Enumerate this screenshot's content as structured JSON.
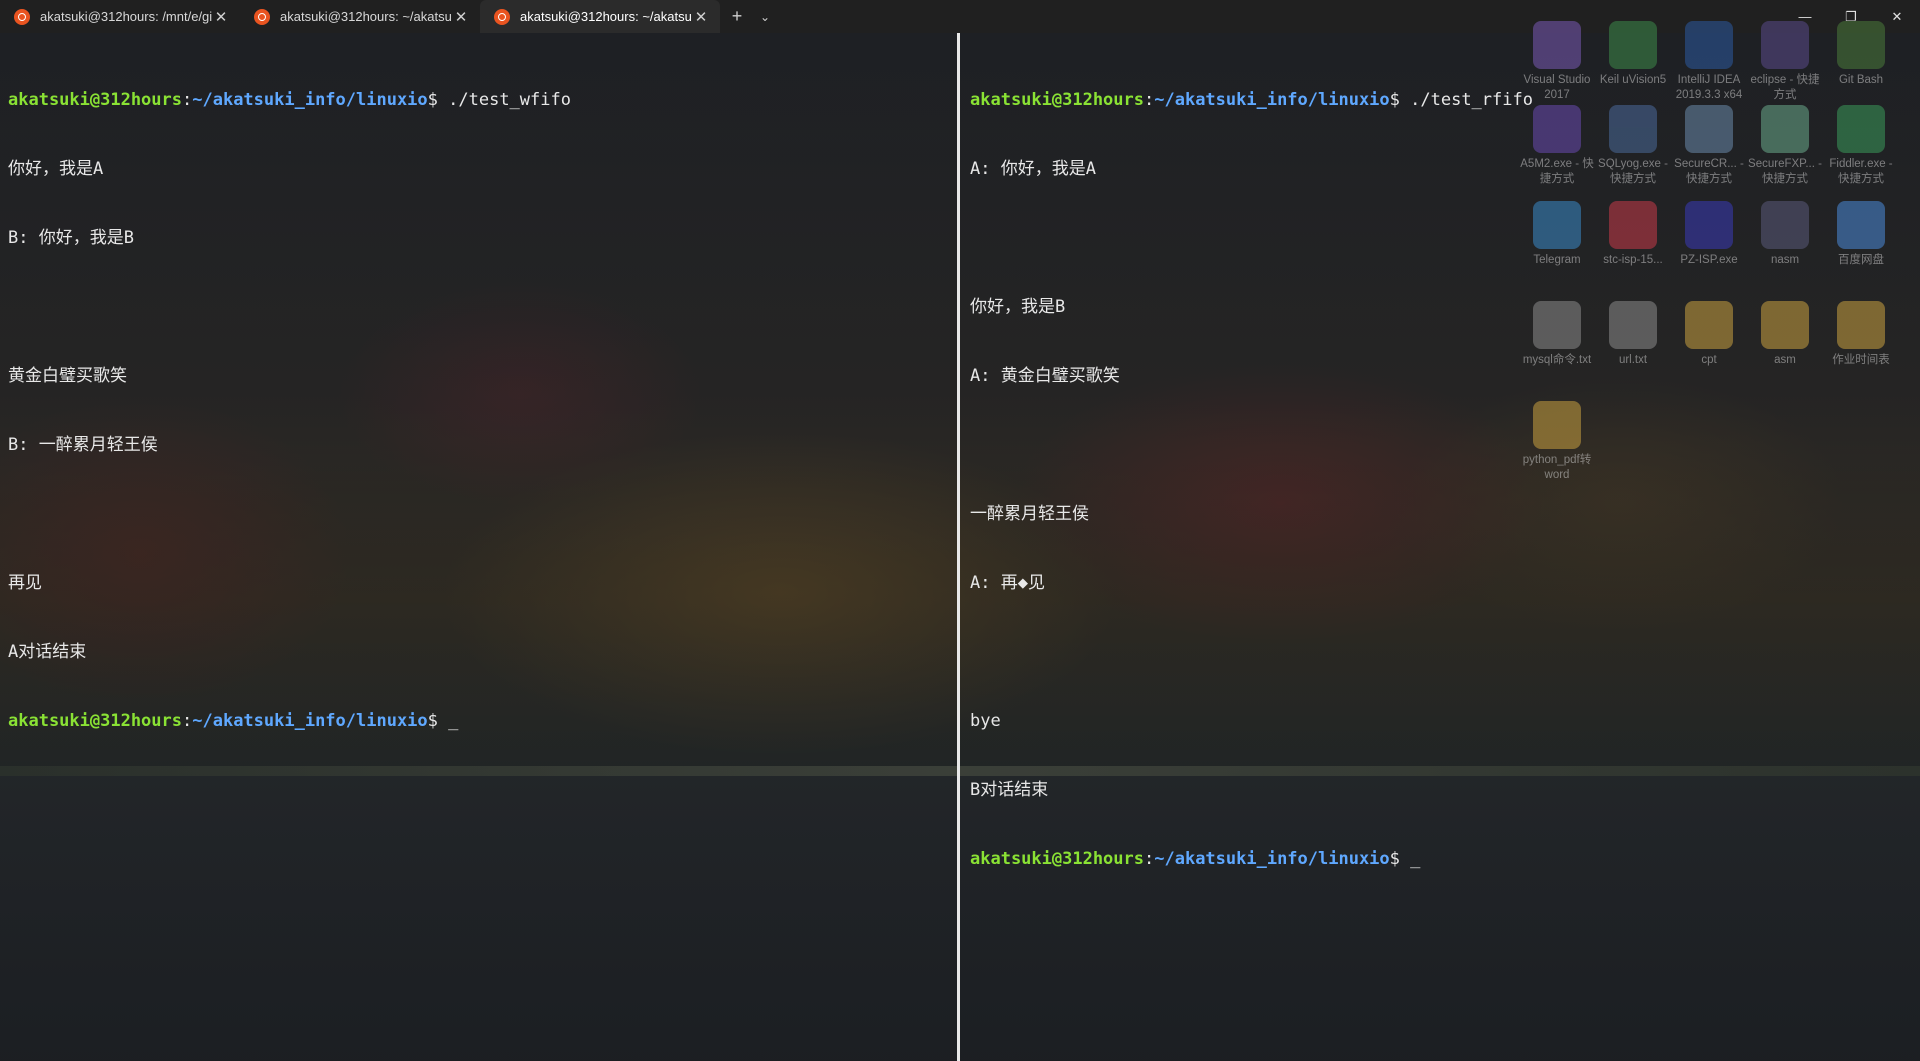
{
  "tabs": [
    {
      "title": "akatsuki@312hours: /mnt/e/gi",
      "active": false
    },
    {
      "title": "akatsuki@312hours: ~/akatsuk",
      "active": false
    },
    {
      "title": "akatsuki@312hours: ~/akatsu",
      "active": true
    }
  ],
  "tab_close_glyph": "✕",
  "newtab_glyph": "+",
  "dropdown_glyph": "⌄",
  "window": {
    "minimize": "—",
    "restore": "❐",
    "close": "✕"
  },
  "left_pane": {
    "prompt1": {
      "user": "akatsuki@312hours",
      "sep": ":",
      "path": "~/akatsuki_info/linuxio",
      "end": "$ ",
      "cmd": "./test_wfifo"
    },
    "lines": [
      "你好，我是A",
      "B: 你好，我是B",
      "",
      "黄金白璧买歌笑",
      "B: 一醉累月轻王侯",
      "",
      "再见",
      "A对话结束"
    ],
    "prompt2": {
      "user": "akatsuki@312hours",
      "sep": ":",
      "path": "~/akatsuki_info/linuxio",
      "end": "$ ",
      "cmd": "_"
    }
  },
  "right_pane": {
    "prompt1": {
      "user": "akatsuki@312hours",
      "sep": ":",
      "path": "~/akatsuki_info/linuxio",
      "end": "$ ",
      "cmd": "./test_rfifo"
    },
    "lines": [
      "A: 你好，我是A",
      "",
      "你好，我是B",
      "A: 黄金白璧买歌笑",
      "",
      "一醉累月轻王侯",
      "A: 再◆见",
      "",
      "bye",
      "B对话结束"
    ],
    "prompt2": {
      "user": "akatsuki@312hours",
      "sep": ":",
      "path": "~/akatsuki_info/linuxio",
      "end": "$ ",
      "cmd": "_"
    }
  },
  "desktop_icons": [
    {
      "label": "Visual Studio 2017",
      "color": "#7a5ab5"
    },
    {
      "label": "Keil uVision5",
      "color": "#3d8a4a"
    },
    {
      "label": "IntelliJ IDEA 2019.3.3 x64",
      "color": "#2c5aa0"
    },
    {
      "label": "eclipse - 快捷方式",
      "color": "#5a4a8a"
    },
    {
      "label": "Git Bash",
      "color": "#4a7a3a"
    },
    {
      "label": "A5M2.exe - 快捷方式",
      "color": "#6a4ab0"
    },
    {
      "label": "SQLyog.exe - 快捷方式",
      "color": "#4a6a9a"
    },
    {
      "label": "SecureCR... - 快捷方式",
      "color": "#6a8aaa"
    },
    {
      "label": "SecureFXP... - 快捷方式",
      "color": "#6aaa8a"
    },
    {
      "label": "Fiddler.exe - 快捷方式",
      "color": "#3a9a5a"
    },
    {
      "label": "Telegram",
      "color": "#3a8ac8"
    },
    {
      "label": "stc-isp-15...",
      "color": "#c83a4a"
    },
    {
      "label": "PZ-ISP.exe",
      "color": "#3a3ab8"
    },
    {
      "label": "nasm",
      "color": "#5a5a7a"
    },
    {
      "label": "百度网盘",
      "color": "#4a8ad8"
    },
    {
      "label": "mysql命令.txt",
      "color": "#8a8a8a"
    },
    {
      "label": "url.txt",
      "color": "#8a8a8a"
    },
    {
      "label": "cpt",
      "color": "#c8a040"
    },
    {
      "label": "asm",
      "color": "#c8a040"
    },
    {
      "label": "作业时间表",
      "color": "#c8a040"
    },
    {
      "label": "python_pdf转word",
      "color": "#c8a040"
    }
  ]
}
